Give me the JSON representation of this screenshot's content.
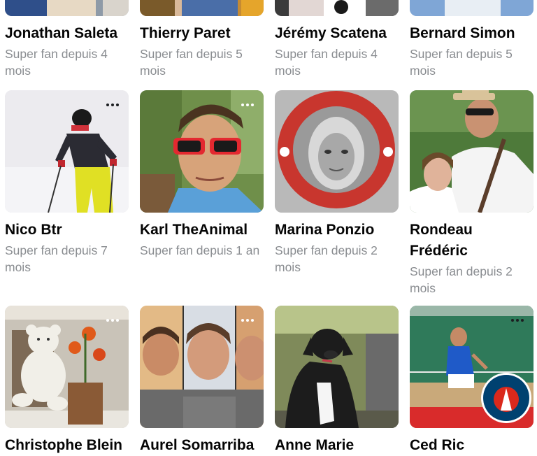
{
  "fans": [
    {
      "name": "Jonathan Saleta",
      "subtitle": "Super fan depuis 4 mois",
      "photo_icon": "person-photo"
    },
    {
      "name": "Thierry Paret",
      "subtitle": "Super fan depuis 5 mois",
      "photo_icon": "person-photo"
    },
    {
      "name": "Jérémy Scatena",
      "subtitle": "Super fan depuis 4 mois",
      "photo_icon": "person-photo"
    },
    {
      "name": "Bernard Simon",
      "subtitle": "Super fan depuis 5 mois",
      "photo_icon": "person-photo"
    },
    {
      "name": "Nico Btr",
      "subtitle": "Super fan depuis 7 mois",
      "photo_icon": "skier-photo"
    },
    {
      "name": "Karl TheAnimal",
      "subtitle": "Super fan depuis 1 an",
      "photo_icon": "selfie-photo"
    },
    {
      "name": "Marina Ponzio",
      "subtitle": "Super fan depuis 2 mois",
      "photo_icon": "tennis-club-badge-photo"
    },
    {
      "name": "Rondeau Frédéric",
      "subtitle": "Super fan depuis 2 mois",
      "photo_icon": "man-with-child-photo"
    },
    {
      "name": "Christophe Blein",
      "subtitle": "",
      "photo_icon": "teddy-bear-photo"
    },
    {
      "name": "Aurel Somarriba",
      "subtitle": "",
      "photo_icon": "group-selfie-photo"
    },
    {
      "name": "Anne Marie",
      "subtitle": "",
      "photo_icon": "dog-photo"
    },
    {
      "name": "Ced Ric",
      "subtitle": "",
      "photo_icon": "padel-psg-photo"
    }
  ],
  "more_icon": "more-dots-icon",
  "colors": {
    "name_text": "#050505",
    "subtitle_text": "#8a8d91",
    "psg_blue": "#004170",
    "psg_red": "#da291c",
    "badge_red": "#c8362e"
  }
}
